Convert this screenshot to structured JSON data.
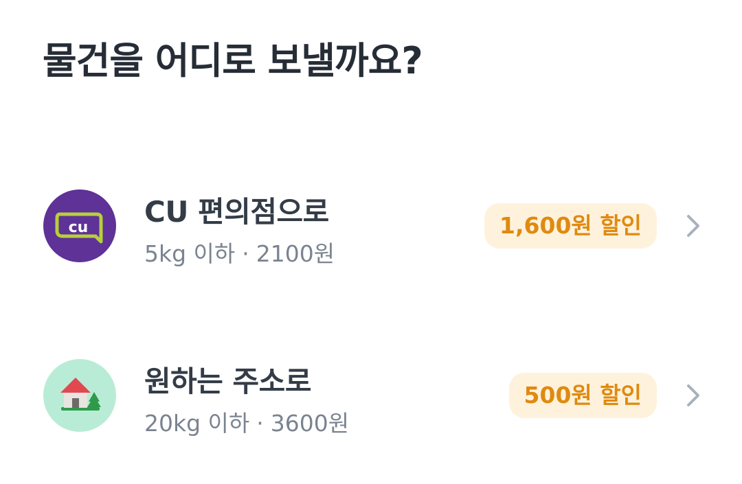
{
  "header": {
    "title": "물건을 어디로 보낼까요?"
  },
  "options": [
    {
      "icon": "cu-logo-icon",
      "title": "CU 편의점으로",
      "weight": "5kg 이하",
      "separator": "·",
      "price": "2100원",
      "badge": "1,600원 할인",
      "icon_bg": "#5e3297"
    },
    {
      "icon": "house-icon",
      "title": "원하는 주소로",
      "weight": "20kg 이하",
      "separator": "·",
      "price": "3600원",
      "badge": "500원 할인",
      "icon_bg": "#b9ecd6"
    }
  ],
  "colors": {
    "badge_bg": "#fff2dc",
    "badge_text": "#df8a10",
    "chevron": "#a9b1bb"
  }
}
